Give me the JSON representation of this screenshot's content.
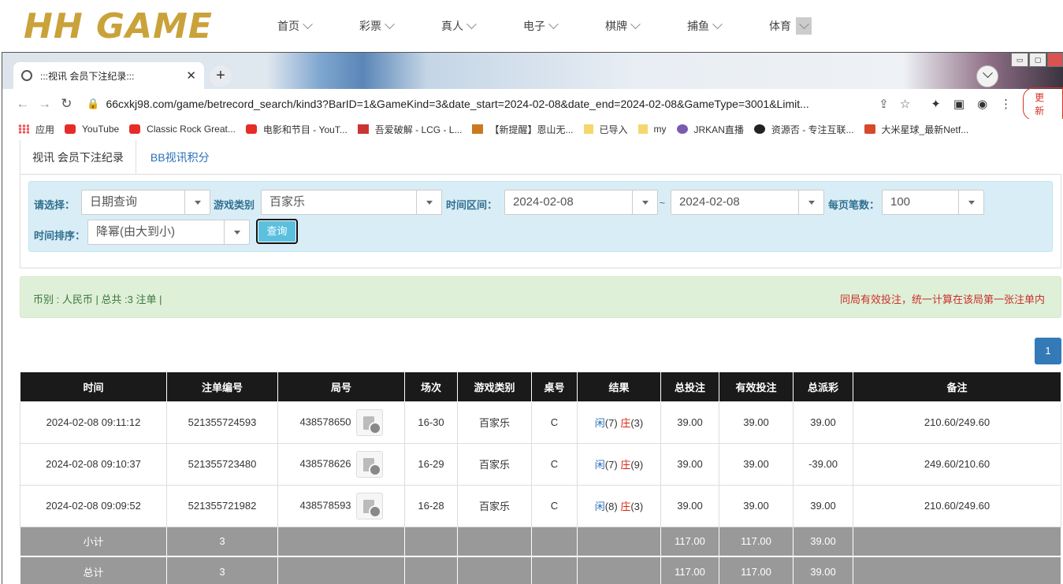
{
  "site": {
    "logo": "HH GAME",
    "nav": [
      "首页",
      "彩票",
      "真人",
      "电子",
      "棋牌",
      "捕鱼",
      "体育"
    ]
  },
  "browser": {
    "tab_title": ":::视讯 会员下注纪录:::",
    "url": "66cxkj98.com/game/betrecord_search/kind3?BarID=1&GameKind=3&date_start=2024-02-08&date_end=2024-02-08&GameType=3001&Limit...",
    "update_label": "更新",
    "bookmarks": [
      "应用",
      "YouTube",
      "Classic Rock Great...",
      "电影和节目 - YouT...",
      "吾爱破解 - LCG - L...",
      "【新提醒】恩山无...",
      "已导入",
      "my",
      "JRKAN直播",
      "资源否 - 专注互联...",
      "大米星球_最新Netf..."
    ]
  },
  "page": {
    "tabs": [
      "视讯 会员下注纪录",
      "BB视讯积分"
    ],
    "filter": {
      "select_label": "请选择：",
      "select_value": "日期查询",
      "game_type_label": "游戏类别",
      "game_type_value": "百家乐",
      "date_label": "时间区间：",
      "date_start": "2024-02-08",
      "tilde": "~",
      "date_end": "2024-02-08",
      "per_page_label": "每页笔数：",
      "per_page_value": "100",
      "sort_label": "时间排序：",
      "sort_value": "降幂(由大到小)",
      "query_button": "查询"
    },
    "info_left": "币别 : 人民币 | 总共 :3 注单 |",
    "info_right": "同局有效投注，统一计算在该局第一张注单内",
    "page_number": "1"
  },
  "table": {
    "headers": [
      "时间",
      "注单编号",
      "局号",
      "场次",
      "游戏类别",
      "桌号",
      "结果",
      "总投注",
      "有效投注",
      "总派彩",
      "备注"
    ],
    "rows": [
      {
        "time": "2024-02-08 09:11:12",
        "bet_no": "521355724593",
        "round": "438578650",
        "session": "16-30",
        "game": "百家乐",
        "table": "C",
        "r1": "闲",
        "r1v": "(7)",
        "r2": "庄",
        "r2v": "(3)",
        "total": "39.00",
        "valid": "39.00",
        "payout": "39.00",
        "note": "210.60/249.60"
      },
      {
        "time": "2024-02-08 09:10:37",
        "bet_no": "521355723480",
        "round": "438578626",
        "session": "16-29",
        "game": "百家乐",
        "table": "C",
        "r1": "闲",
        "r1v": "(7)",
        "r2": "庄",
        "r2v": "(9)",
        "total": "39.00",
        "valid": "39.00",
        "payout": "-39.00",
        "note": "249.60/210.60"
      },
      {
        "time": "2024-02-08 09:09:52",
        "bet_no": "521355721982",
        "round": "438578593",
        "session": "16-28",
        "game": "百家乐",
        "table": "C",
        "r1": "闲",
        "r1v": "(8)",
        "r2": "庄",
        "r2v": "(3)",
        "total": "39.00",
        "valid": "39.00",
        "payout": "39.00",
        "note": "210.60/249.60"
      }
    ],
    "subtotal": {
      "label": "小计",
      "count": "3",
      "total": "117.00",
      "valid": "117.00",
      "payout": "39.00"
    },
    "grandtotal": {
      "label": "总计",
      "count": "3",
      "total": "117.00",
      "valid": "117.00",
      "payout": "39.00"
    }
  }
}
